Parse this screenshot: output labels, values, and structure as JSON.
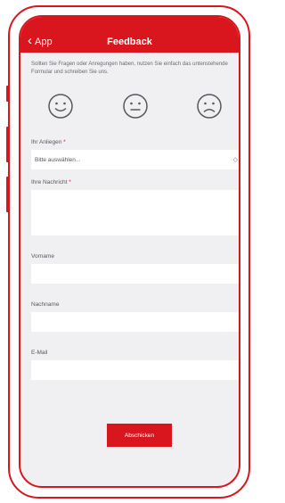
{
  "nav": {
    "back_label": "App",
    "title": "Feedback"
  },
  "intro_text": "Sollten Sie Fragen oder Anregungen haben, nutzen Sie einfach das untenstehende Formular und schreiben Sie uns.",
  "smileys": [
    "happy-face-icon",
    "neutral-face-icon",
    "sad-face-icon"
  ],
  "form": {
    "concern_label": "Ihr Anliegen",
    "concern_placeholder": "Bitte auswählen...",
    "message_label": "Ihre Nachricht",
    "firstname_label": "Vorname",
    "lastname_label": "Nachname",
    "email_label": "E-Mail",
    "required_marker": "*",
    "submit_label": "Abschicken"
  },
  "colors": {
    "accent": "#d9161e",
    "background": "#f0f0f2"
  }
}
